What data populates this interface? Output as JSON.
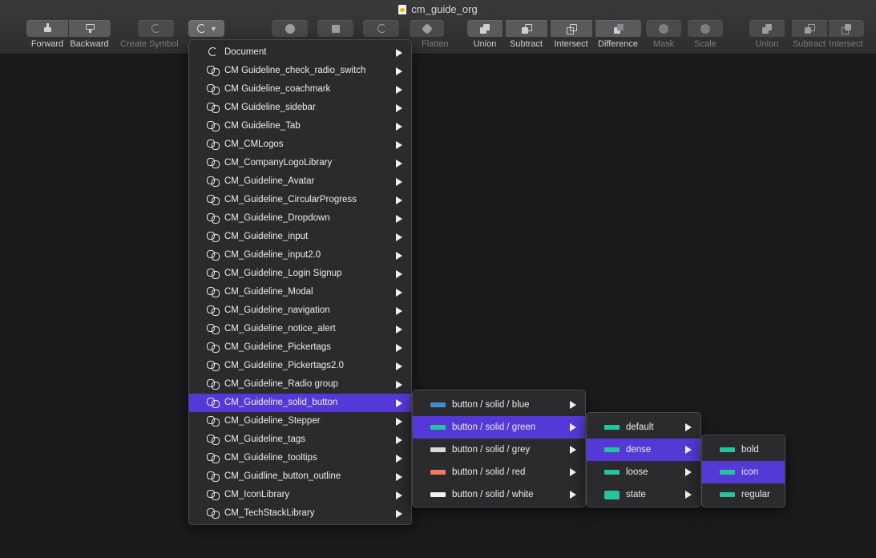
{
  "window": {
    "title": "cm_guide_org"
  },
  "toolbar": {
    "forward": "Forward",
    "backward": "Backward",
    "create_symbol": "Create Symbol",
    "flatten": "Flatten",
    "union": "Union",
    "subtract": "Subtract",
    "intersect": "Intersect",
    "difference": "Difference",
    "mask": "Mask",
    "scale": "Scale",
    "union2": "Union",
    "subtract2": "Subtract",
    "intersect2": "Intersect"
  },
  "symbols_menu": {
    "items": [
      "Document",
      "CM Guideline_check_radio_switch",
      "CM Guideline_coachmark",
      "CM Guideline_sidebar",
      "CM Guideline_Tab",
      "CM_CMLogos",
      "CM_CompanyLogoLibrary",
      "CM_Guideline_Avatar",
      "CM_Guideline_CircularProgress",
      "CM_Guideline_Dropdown",
      "CM_Guideline_input",
      "CM_Guideline_input2.0",
      "CM_Guideline_Login Signup",
      "CM_Guideline_Modal",
      "CM_Guideline_navigation",
      "CM_Guideline_notice_alert",
      "CM_Guideline_Pickertags",
      "CM_Guideline_Pickertags2.0",
      "CM_Guideline_Radio group",
      "CM_Guideline_solid_button",
      "CM_Guideline_Stepper",
      "CM_Guideline_tags",
      "CM_Guideline_tooltips",
      "CM_Guidline_button_outline",
      "CM_IconLibrary",
      "CM_TechStackLibrary"
    ],
    "selected_index": 19
  },
  "solid_button_menu": {
    "items": [
      "button / solid / blue",
      "button / solid / green",
      "button / solid / grey",
      "button / solid / red",
      "button / solid / white"
    ],
    "thumb_colors": [
      "#3b8ed6",
      "#27c3a0",
      "#d9d9d9",
      "#f07a5a",
      "#f2f2f2"
    ],
    "selected_index": 1
  },
  "green_menu": {
    "items": [
      "default",
      "dense",
      "loose",
      "state"
    ],
    "thumb_color": "#25c4a0",
    "selected_index": 1
  },
  "dense_menu": {
    "items": [
      "bold",
      "icon",
      "regular"
    ],
    "thumb_color": "#25c4a0",
    "selected_index": 1
  },
  "colors": {
    "highlight": "#5539d6",
    "menu_bg": "#2b2b2d",
    "canvas": "#1b1b1d"
  }
}
